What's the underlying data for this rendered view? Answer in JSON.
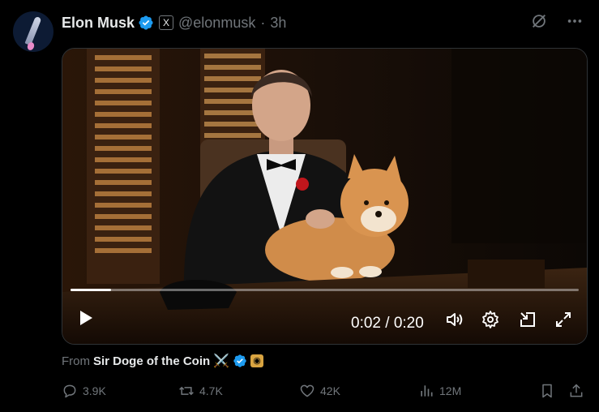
{
  "tweet": {
    "author_name": "Elon Musk",
    "handle": "@elonmusk",
    "separator": "·",
    "time": "3h",
    "x_badge": "X"
  },
  "video": {
    "current_time": "0:02",
    "duration": "0:20",
    "time_display": "0:02 / 0:20",
    "progress_fraction": 0.08
  },
  "attribution": {
    "prefix": "From",
    "source_name": "Sir Doge of the Coin",
    "emoji": "⚔️"
  },
  "metrics": {
    "replies": "3.9K",
    "reposts": "4.7K",
    "likes": "42K",
    "views": "12M"
  },
  "colors": {
    "background": "#000000",
    "text": "#e7e9ea",
    "muted": "#71767b",
    "verified": "#1d9bf0"
  }
}
